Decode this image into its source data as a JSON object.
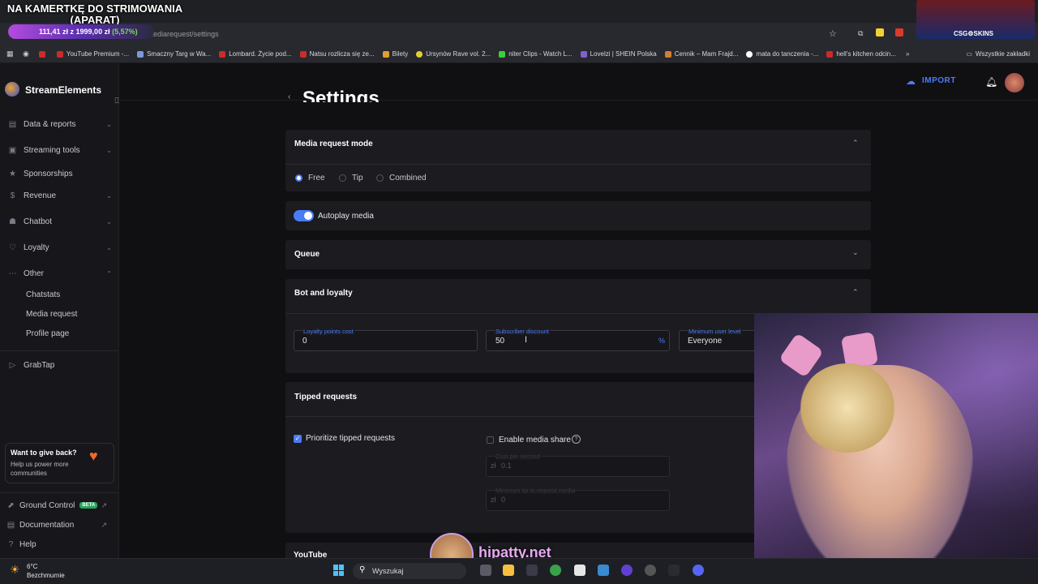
{
  "overlay": {
    "title": "NA KAMERTKĘ DO STRIMOWANIA (APARAT)",
    "progress_text": "111,41 zł z 1999,00 zł",
    "progress_pct": "(5,57%)",
    "progress_fraction": 0.0557,
    "csgo_label": "CSG⚙SKINS"
  },
  "browser": {
    "url": "...ats.com/dashboard/mediarequest/settings",
    "bookmarks": [
      "YouTube Premium -...",
      "Smaczny Targ w Wa...",
      "Lombard. Życie pod...",
      "Natsu rozlicza się ze...",
      "Bilety",
      "Ursynów Rave vol. 2...",
      "niter Clips - Watch L...",
      "Lovelzi | SHEIN Polska",
      "Cennik – Mam Frajd...",
      "mata do tanczenia -...",
      "hell's kitchen odcin..."
    ],
    "all_bookmarks": "Wszystkie zakładki"
  },
  "sidebar": {
    "brand": "StreamElements",
    "items": [
      {
        "label": "Data & reports",
        "icon": "chart-icon"
      },
      {
        "label": "Streaming tools",
        "icon": "tools-icon"
      },
      {
        "label": "Sponsorships",
        "icon": "star-icon"
      },
      {
        "label": "Revenue",
        "icon": "dollar-icon"
      },
      {
        "label": "Chatbot",
        "icon": "bot-icon"
      },
      {
        "label": "Loyalty",
        "icon": "heart-icon"
      },
      {
        "label": "Other",
        "icon": "dots-icon"
      }
    ],
    "sub_items": [
      "Chatstats",
      "Media request",
      "Profile page"
    ],
    "grabtap": "GrabTap",
    "give_title": "Want to give back?",
    "give_sub": "Help us power more communities",
    "ground_control": "Ground Control",
    "beta": "BETA",
    "documentation": "Documentation",
    "help": "Help"
  },
  "header": {
    "import": "IMPORT",
    "page_title": "Settings"
  },
  "media_request_mode": {
    "title": "Media request mode",
    "options": [
      "Free",
      "Tip",
      "Combined"
    ],
    "selected": "Free"
  },
  "autoplay": {
    "label": "Autoplay media",
    "on": true
  },
  "queue": {
    "title": "Queue"
  },
  "bot_loyalty": {
    "title": "Bot and loyalty",
    "loyalty_label": "Loyalty points cost",
    "loyalty_value": "0",
    "discount_label": "Subscriber discount",
    "discount_value": "50",
    "discount_unit": "%",
    "min_level_label": "Minimum user level",
    "min_level_value": "Everyone"
  },
  "tipped": {
    "title": "Tipped requests",
    "prioritize": "Prioritize tipped requests",
    "enable_share": "Enable media share",
    "cost_label": "Cost per second",
    "cost_value": "0.1",
    "min_tip_label": "Minimum tip to request media",
    "min_tip_value": "0",
    "currency": "zł"
  },
  "youtube": {
    "title": "YouTube"
  },
  "stream_overlay": {
    "handle": "hipatty.net"
  },
  "taskbar": {
    "temp": "6°C",
    "weather": "Bezchmurnie",
    "search": "Wyszukaj"
  },
  "colors": {
    "accent": "#4b7cf5",
    "panel": "#1b1b20",
    "background": "#101013"
  }
}
